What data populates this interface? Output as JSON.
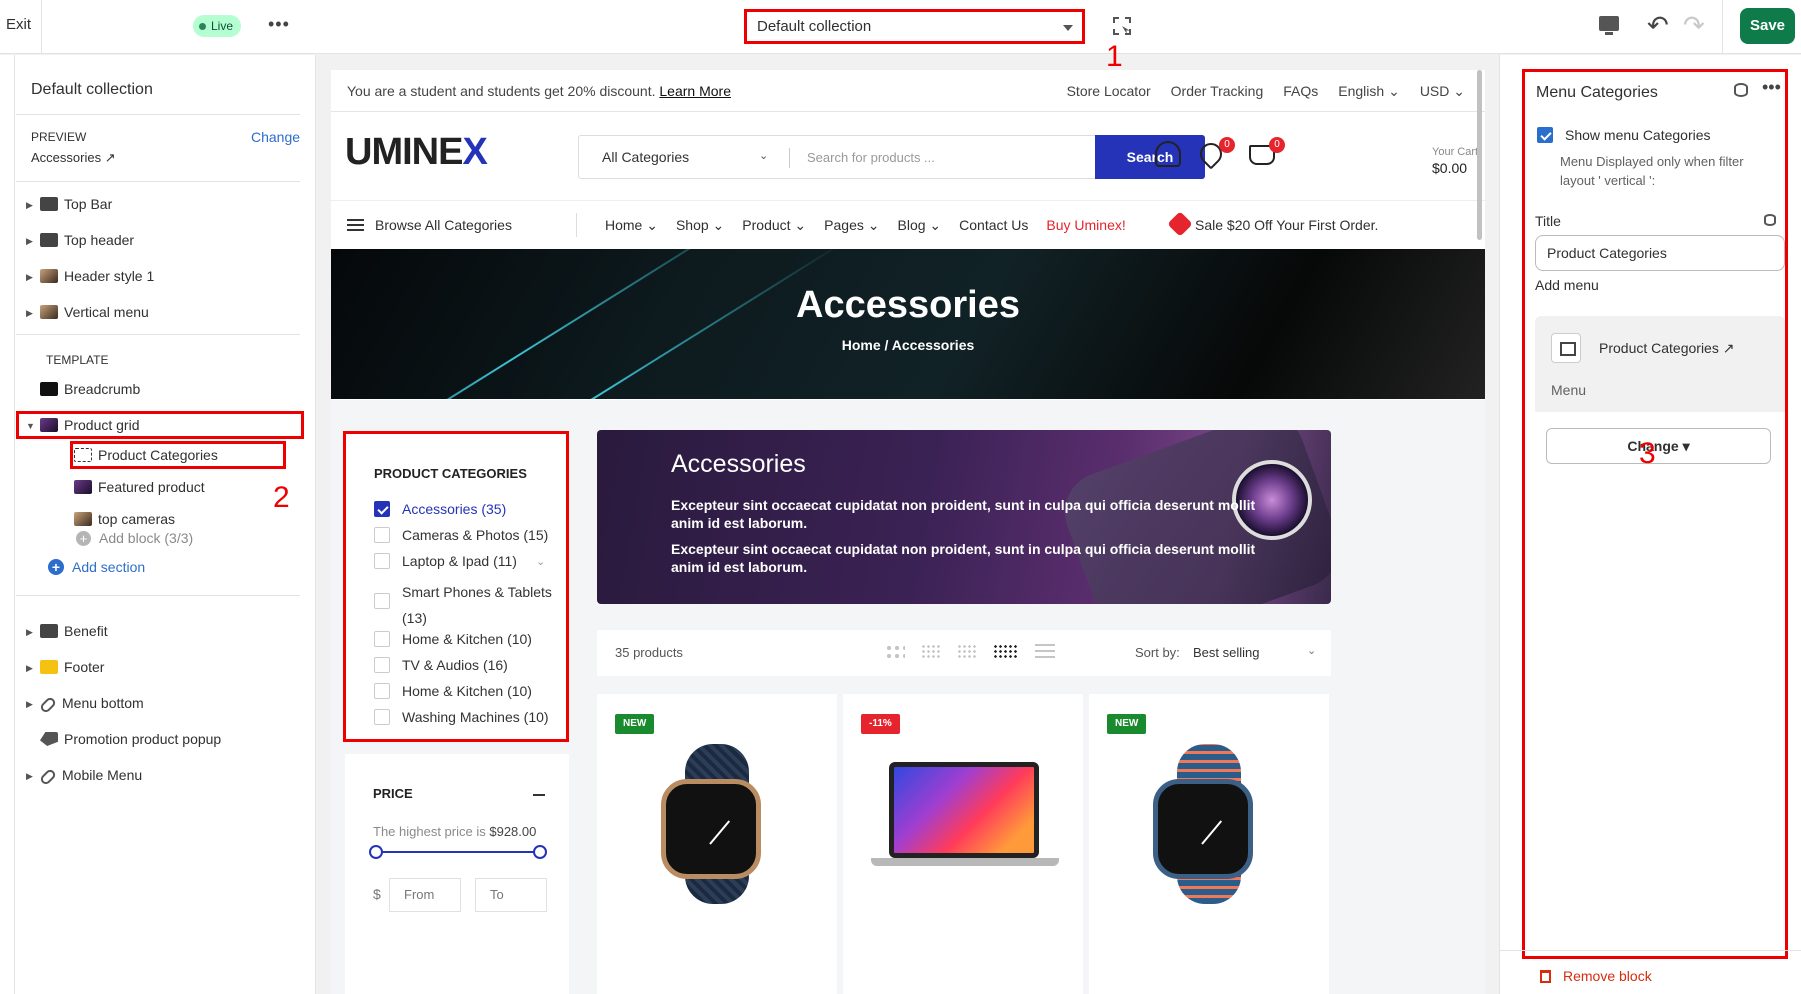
{
  "topbar": {
    "exit_label": "Exit",
    "live_label": "Live",
    "more_label": "•••",
    "collection_select": "Default collection",
    "annotation_1": "1",
    "save_label": "Save",
    "undo_glyph": "↶",
    "redo_glyph": "↷"
  },
  "left_panel": {
    "title": "Default collection",
    "preview_label": "PREVIEW",
    "change_label": "Change",
    "preview_value": "Accessories ↗",
    "sections_top": [
      {
        "label": "Top Bar",
        "icon": "top-bar-section-icon"
      },
      {
        "label": "Top header",
        "icon": "top-header-section-icon"
      },
      {
        "label": "Header style 1",
        "icon": "header-style-thumbnail-icon"
      },
      {
        "label": "Vertical menu",
        "icon": "vertical-menu-thumbnail-icon"
      }
    ],
    "template_label": "TEMPLATE",
    "breadcrumb_label": "Breadcrumb",
    "product_grid_label": "Product grid",
    "blocks": [
      {
        "label": "Product Categories",
        "icon": "block-dashed-icon"
      },
      {
        "label": "Featured product",
        "icon": "featured-product-thumbnail-icon"
      },
      {
        "label": "top cameras",
        "icon": "top-cameras-thumbnail-icon"
      }
    ],
    "add_block_label": "Add block (3/3)",
    "add_section_label": "Add section",
    "annotation_2": "2",
    "sections_bottom": [
      {
        "label": "Benefit",
        "icon": "benefit-section-icon"
      },
      {
        "label": "Footer",
        "icon": "footer-section-icon"
      },
      {
        "label": "Menu bottom",
        "icon": "link-icon"
      },
      {
        "label": "Promotion product popup",
        "icon": "tag-icon"
      },
      {
        "label": "Mobile Menu",
        "icon": "link-icon"
      }
    ]
  },
  "store": {
    "promo_text": "You are a student and students get 20% discount.",
    "promo_link": "Learn More",
    "top_links": [
      "Store Locator",
      "Order Tracking",
      "FAQs",
      "English ⌄",
      "USD ⌄"
    ],
    "logo_main": "UMINE",
    "logo_accent": "X",
    "search_category": "All Categories",
    "search_placeholder": "Search for products ...",
    "search_button": "Search",
    "wishlist_count": "0",
    "cart_count": "0",
    "cart_label": "Your Cart",
    "cart_value": "$0.00",
    "browse_label": "Browse All Categories",
    "nav_items": [
      "Home ⌄",
      "Shop ⌄",
      "Product ⌄",
      "Pages ⌄",
      "Blog ⌄",
      "Contact Us"
    ],
    "nav_buy": "Buy Uminex!",
    "sale_text": "Sale $20 Off Your First Order.",
    "hero_title": "Accessories",
    "hero_crumb": "Home / Accessories",
    "categories_title": "PRODUCT CATEGORIES",
    "categories": [
      {
        "label": "Accessories",
        "count": "(35)",
        "checked": true
      },
      {
        "label": "Cameras & Photos",
        "count": "(15)",
        "checked": false
      },
      {
        "label": "Laptop & Ipad",
        "count": "(11)",
        "checked": false
      },
      {
        "label": "Smart Phones & Tablets",
        "count": "(13)",
        "checked": false
      },
      {
        "label": "Home & Kitchen",
        "count": "(10)",
        "checked": false
      },
      {
        "label": "TV & Audios",
        "count": "(16)",
        "checked": false
      },
      {
        "label": "Home & Kitchen",
        "count": "(10)",
        "checked": false
      },
      {
        "label": "Washing Machines",
        "count": "(10)",
        "checked": false
      }
    ],
    "price_title": "PRICE",
    "price_hint": "The highest price is",
    "price_max": "$928.00",
    "price_currency": "$",
    "price_from": "From",
    "price_to": "To",
    "banner_title": "Accessories",
    "banner_p1": "Excepteur sint occaecat cupidatat non proident, sunt in culpa qui officia deserunt mollit anim id est laborum.",
    "banner_p2": "Excepteur sint occaecat cupidatat non proident, sunt in culpa qui officia deserunt mollit anim id est laborum.",
    "product_count": "35 products",
    "sort_label": "Sort by:",
    "sort_value": "Best selling",
    "products": [
      {
        "tag": "NEW",
        "tag_color": "#1a8a2e"
      },
      {
        "tag": "-11%",
        "tag_color": "#e5242d"
      },
      {
        "tag": "NEW",
        "tag_color": "#1a8a2e"
      }
    ]
  },
  "right_panel": {
    "title": "Menu Categories",
    "show_menu_label": "Show menu Categories",
    "show_menu_checked": true,
    "show_menu_help": "Menu Displayed only when filter layout ' vertical ':",
    "title_label": "Title",
    "title_value": "Product Categories",
    "add_menu_label": "Add menu",
    "menu_name": "Product Categories ↗",
    "menu_sub": "Menu",
    "change_button": "Change ▾",
    "annotation_3": "3",
    "remove_label": "Remove block"
  },
  "colors": {
    "annotation_red": "#e00000",
    "save_green": "#0f7b4b",
    "store_blue": "#2433b8",
    "link_blue": "#2c6ecb"
  }
}
